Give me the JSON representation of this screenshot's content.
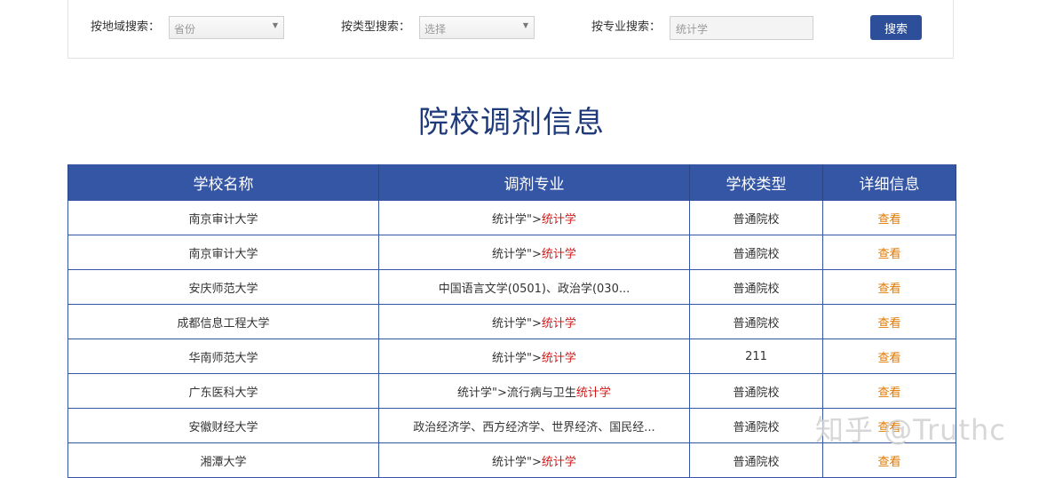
{
  "search": {
    "region_label": "按地域搜索：",
    "region_placeholder": "省份",
    "type_label": "按类型搜索：",
    "type_placeholder": "选择",
    "major_label": "按专业搜索：",
    "major_value": "统计学",
    "search_button": "搜索"
  },
  "page_title": "院校调剂信息",
  "table": {
    "headers": [
      "学校名称",
      "调剂专业",
      "学校类型",
      "详细信息"
    ],
    "rows": [
      {
        "school": "南京审计大学",
        "major_prefix": "统计学\">",
        "major_highlight": "统计学",
        "type": "普通院校",
        "detail": "查看"
      },
      {
        "school": "南京审计大学",
        "major_prefix": "统计学\">",
        "major_highlight": "统计学",
        "type": "普通院校",
        "detail": "查看"
      },
      {
        "school": "安庆师范大学",
        "major_prefix": "中国语言文学(0501)、政治学(030...",
        "major_highlight": "",
        "type": "普通院校",
        "detail": "查看"
      },
      {
        "school": "成都信息工程大学",
        "major_prefix": "统计学\">",
        "major_highlight": "统计学",
        "type": "普通院校",
        "detail": "查看"
      },
      {
        "school": "华南师范大学",
        "major_prefix": "统计学\">",
        "major_highlight": "统计学",
        "type": "211",
        "detail": "查看"
      },
      {
        "school": "广东医科大学",
        "major_prefix": "统计学\">流行病与卫生",
        "major_highlight": "统计学",
        "type": "普通院校",
        "detail": "查看"
      },
      {
        "school": "安徽财经大学",
        "major_prefix": "政治经济学、西方经济学、世界经济、国民经...",
        "major_highlight": "",
        "type": "普通院校",
        "detail": "查看"
      },
      {
        "school": "湘潭大学",
        "major_prefix": "统计学\">",
        "major_highlight": "统计学",
        "type": "普通院校",
        "detail": "查看"
      }
    ]
  },
  "watermark": "知乎 @Truthc",
  "colors": {
    "header_bg": "#3556a4",
    "title": "#1f3a7a",
    "button": "#2d4f99",
    "highlight": "#d11a1a",
    "link": "#e07800"
  }
}
